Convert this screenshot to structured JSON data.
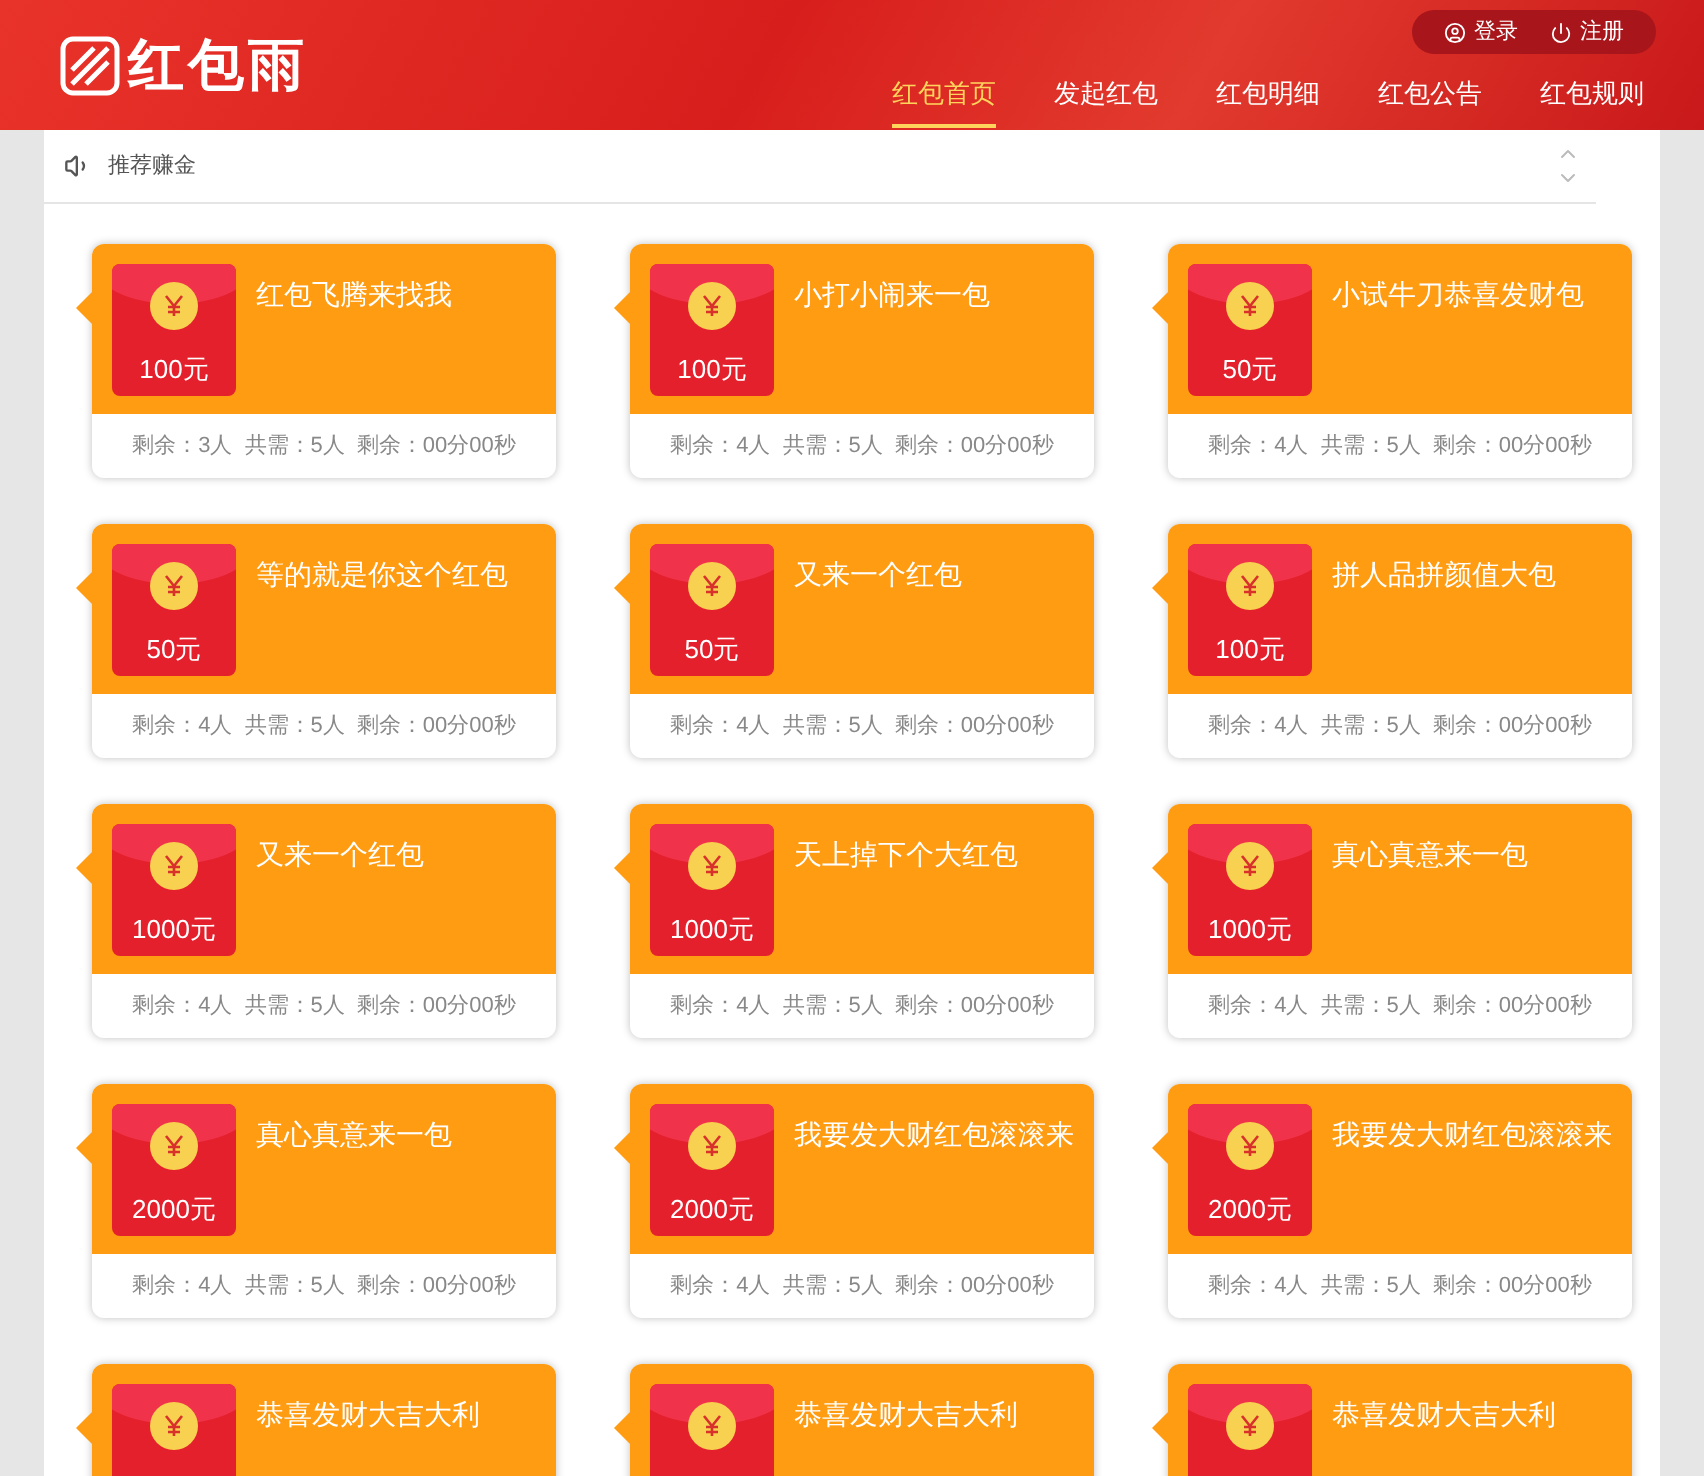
{
  "header": {
    "logo_text": "红包雨",
    "nav": [
      {
        "label": "红包首页",
        "selected": true
      },
      {
        "label": "发起红包",
        "selected": false
      },
      {
        "label": "红包明细",
        "selected": false
      },
      {
        "label": "红包公告",
        "selected": false
      },
      {
        "label": "红包规则",
        "selected": false
      }
    ],
    "account": [
      {
        "kind": "login",
        "label": "登录"
      },
      {
        "kind": "register",
        "label": "注册"
      }
    ]
  },
  "notice": {
    "text": "推荐赚金"
  },
  "cards": [
    {
      "title": "红包飞腾来找我",
      "amount": "100元",
      "stats": [
        "剩余：3人",
        "共需：5人",
        "剩余：00分00秒"
      ]
    },
    {
      "title": "小打小闹来一包",
      "amount": "100元",
      "stats": [
        "剩余：4人",
        "共需：5人",
        "剩余：00分00秒"
      ]
    },
    {
      "title": "小试牛刀恭喜发财包",
      "amount": "50元",
      "stats": [
        "剩余：4人",
        "共需：5人",
        "剩余：00分00秒"
      ]
    },
    {
      "title": "等的就是你这个红包",
      "amount": "50元",
      "stats": [
        "剩余：4人",
        "共需：5人",
        "剩余：00分00秒"
      ]
    },
    {
      "title": "又来一个红包",
      "amount": "50元",
      "stats": [
        "剩余：4人",
        "共需：5人",
        "剩余：00分00秒"
      ]
    },
    {
      "title": "拼人品拼颜值大包",
      "amount": "100元",
      "stats": [
        "剩余：4人",
        "共需：5人",
        "剩余：00分00秒"
      ]
    },
    {
      "title": "又来一个红包",
      "amount": "1000元",
      "stats": [
        "剩余：4人",
        "共需：5人",
        "剩余：00分00秒"
      ]
    },
    {
      "title": "天上掉下个大红包",
      "amount": "1000元",
      "stats": [
        "剩余：4人",
        "共需：5人",
        "剩余：00分00秒"
      ]
    },
    {
      "title": "真心真意来一包",
      "amount": "1000元",
      "stats": [
        "剩余：4人",
        "共需：5人",
        "剩余：00分00秒"
      ]
    },
    {
      "title": "真心真意来一包",
      "amount": "2000元",
      "stats": [
        "剩余：4人",
        "共需：5人",
        "剩余：00分00秒"
      ]
    },
    {
      "title": "我要发大财红包滚滚来",
      "amount": "2000元",
      "stats": [
        "剩余：4人",
        "共需：5人",
        "剩余：00分00秒"
      ]
    },
    {
      "title": "我要发大财红包滚滚来",
      "amount": "2000元",
      "stats": [
        "剩余：4人",
        "共需：5人",
        "剩余：00分00秒"
      ]
    },
    {
      "title": "恭喜发财大吉大利"
    },
    {
      "title": "恭喜发财大吉大利"
    },
    {
      "title": "恭喜发财大吉大利"
    }
  ]
}
